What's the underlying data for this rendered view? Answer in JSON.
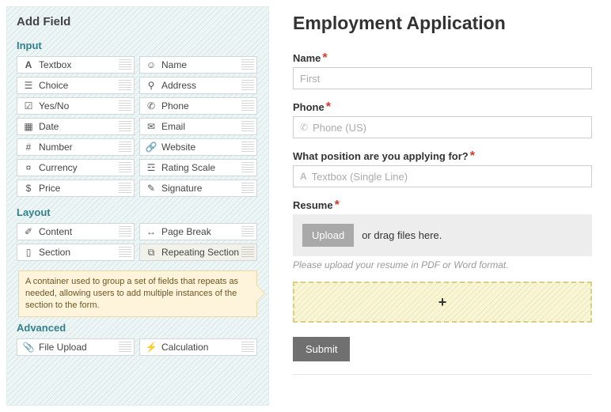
{
  "sidebar": {
    "title": "Add Field",
    "sections": {
      "input": "Input",
      "layout": "Layout",
      "advanced": "Advanced"
    },
    "fields": {
      "textbox": "Textbox",
      "name": "Name",
      "choice": "Choice",
      "address": "Address",
      "yesno": "Yes/No",
      "phone": "Phone",
      "date": "Date",
      "email": "Email",
      "number": "Number",
      "website": "Website",
      "currency": "Currency",
      "rating": "Rating Scale",
      "price": "Price",
      "signature": "Signature",
      "content": "Content",
      "pagebreak": "Page Break",
      "section": "Section",
      "repeating": "Repeating Section",
      "fileupload": "File Upload",
      "calculation": "Calculation"
    },
    "tooltip": "A container used to group a set of fields that repeats as needed, allowing users to add multiple instances of the section to the form."
  },
  "form": {
    "title": "Employment Application",
    "name_label": "Name",
    "name_placeholder": "First",
    "phone_label": "Phone",
    "phone_placeholder": "Phone (US)",
    "position_label": "What position are you applying for?",
    "position_placeholder": "Textbox (Single Line)",
    "resume_label": "Resume",
    "upload_btn": "Upload",
    "upload_hint": "or drag files here.",
    "resume_hint": "Please upload your resume in PDF or Word format.",
    "repeat_add": "+",
    "submit": "Submit"
  }
}
